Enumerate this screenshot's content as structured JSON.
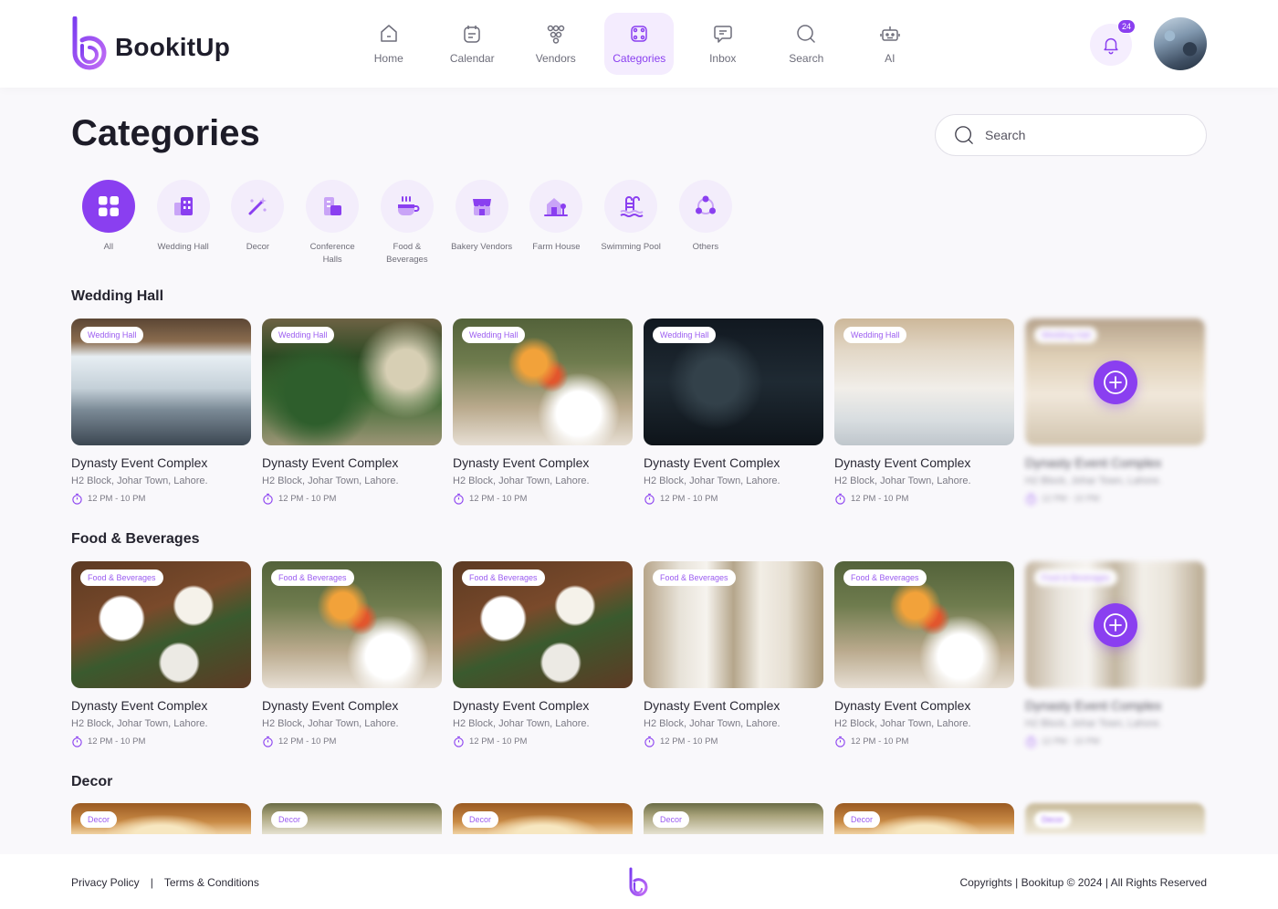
{
  "app": {
    "name": "BookitUp"
  },
  "nav": [
    {
      "label": "Home",
      "icon": "home-icon"
    },
    {
      "label": "Calendar",
      "icon": "calendar-icon"
    },
    {
      "label": "Vendors",
      "icon": "vendors-icon"
    },
    {
      "label": "Categories",
      "icon": "categories-icon",
      "active": true
    },
    {
      "label": "Inbox",
      "icon": "inbox-icon"
    },
    {
      "label": "Search",
      "icon": "search-icon"
    },
    {
      "label": "AI",
      "icon": "robot-icon"
    }
  ],
  "notifications": {
    "count": "24"
  },
  "page": {
    "title": "Categories"
  },
  "search": {
    "placeholder": "Search"
  },
  "categories": [
    {
      "label": "All",
      "icon": "grid-icon",
      "active": true
    },
    {
      "label": "Wedding Hall",
      "icon": "building-icon"
    },
    {
      "label": "Decor",
      "icon": "magic-wand-icon"
    },
    {
      "label": "Conference Halls",
      "icon": "conference-icon"
    },
    {
      "label": "Food & Beverages",
      "icon": "food-icon"
    },
    {
      "label": "Bakery Vendors",
      "icon": "shop-icon"
    },
    {
      "label": "Farm House",
      "icon": "farm-house-icon"
    },
    {
      "label": "Swimming Pool",
      "icon": "pool-icon"
    },
    {
      "label": "Others",
      "icon": "others-icon"
    }
  ],
  "sections": [
    {
      "title": "Wedding Hall",
      "tag": "Wedding Hall",
      "cards": [
        {
          "title": "Dynasty Event Complex",
          "address": "H2 Block, Johar Town, Lahore.",
          "time": "12 PM - 10 PM"
        },
        {
          "title": "Dynasty Event Complex",
          "address": "H2 Block, Johar Town, Lahore.",
          "time": "12 PM - 10 PM"
        },
        {
          "title": "Dynasty Event Complex",
          "address": "H2 Block, Johar Town, Lahore.",
          "time": "12 PM - 10 PM"
        },
        {
          "title": "Dynasty Event Complex",
          "address": "H2 Block, Johar Town, Lahore.",
          "time": "12 PM - 10 PM"
        },
        {
          "title": "Dynasty Event Complex",
          "address": "H2 Block, Johar Town, Lahore.",
          "time": "12 PM - 10 PM"
        },
        {
          "title": "Dynasty Event Complex",
          "address": "H2 Block, Johar Town, Lahore.",
          "time": "12 PM - 10 PM"
        }
      ]
    },
    {
      "title": "Food & Beverages",
      "tag": "Food & Beverages",
      "cards": [
        {
          "title": "Dynasty Event Complex",
          "address": "H2 Block, Johar Town, Lahore.",
          "time": "12 PM - 10 PM"
        },
        {
          "title": "Dynasty Event Complex",
          "address": "H2 Block, Johar Town, Lahore.",
          "time": "12 PM - 10 PM"
        },
        {
          "title": "Dynasty Event Complex",
          "address": "H2 Block, Johar Town, Lahore.",
          "time": "12 PM - 10 PM"
        },
        {
          "title": "Dynasty Event Complex",
          "address": "H2 Block, Johar Town, Lahore.",
          "time": "12 PM - 10 PM"
        },
        {
          "title": "Dynasty Event Complex",
          "address": "H2 Block, Johar Town, Lahore.",
          "time": "12 PM - 10 PM"
        },
        {
          "title": "Dynasty Event Complex",
          "address": "H2 Block, Johar Town, Lahore.",
          "time": "12 PM - 10 PM"
        }
      ]
    },
    {
      "title": "Decor",
      "tag": "Decor"
    }
  ],
  "footer": {
    "privacy": "Privacy Policy",
    "separator": "|",
    "terms": "Terms & Conditions",
    "copyright": "Copyrights | Bookitup © 2024 | All Rights Reserved"
  },
  "colors": {
    "accent": "#8a3ff0",
    "accent_light": "#f3edfb",
    "background": "#f9f8fb"
  }
}
